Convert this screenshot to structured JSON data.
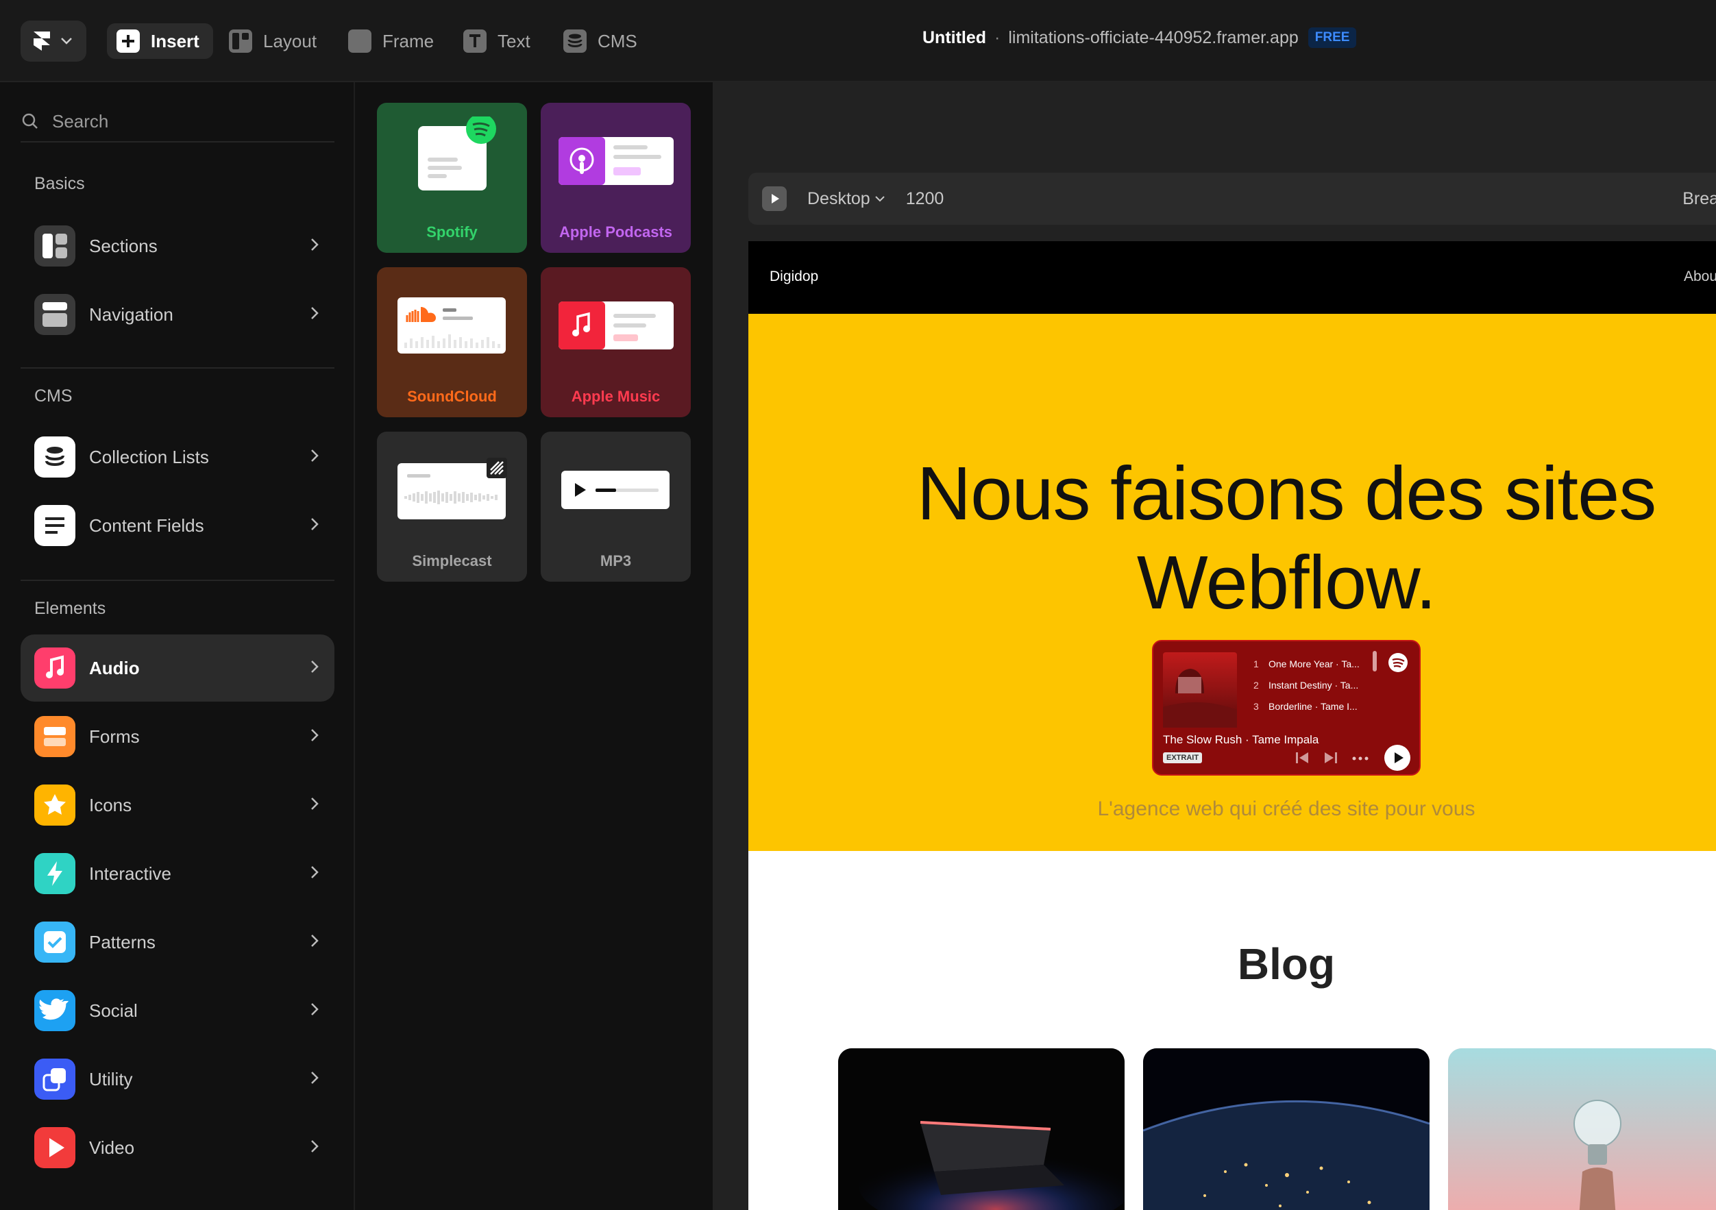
{
  "toolbar": {
    "insert": "Insert",
    "layout": "Layout",
    "frame": "Frame",
    "text": "Text",
    "cms": "CMS"
  },
  "project": {
    "name": "Untitled",
    "separator": "·",
    "url": "limitations-officiate-440952.framer.app",
    "plan": "FREE"
  },
  "sidebar": {
    "search_placeholder": "Search",
    "sections": [
      {
        "title": "Basics",
        "items": [
          {
            "label": "Sections"
          },
          {
            "label": "Navigation"
          }
        ]
      },
      {
        "title": "CMS",
        "items": [
          {
            "label": "Collection Lists"
          },
          {
            "label": "Content Fields"
          }
        ]
      },
      {
        "title": "Elements",
        "items": [
          {
            "label": "Audio",
            "active": true
          },
          {
            "label": "Forms"
          },
          {
            "label": "Icons"
          },
          {
            "label": "Interactive"
          },
          {
            "label": "Patterns"
          },
          {
            "label": "Social"
          },
          {
            "label": "Utility"
          },
          {
            "label": "Video"
          }
        ]
      }
    ]
  },
  "audio_tiles": [
    {
      "label": "Spotify",
      "bg": "#1f5b33",
      "color": "#33d36b"
    },
    {
      "label": "Apple Podcasts",
      "bg": "#4b1f59",
      "color": "#c266f0"
    },
    {
      "label": "SoundCloud",
      "bg": "#5a2c16",
      "color": "#ff6a1a"
    },
    {
      "label": "Apple Music",
      "bg": "#5a1a22",
      "color": "#ff3b4f"
    },
    {
      "label": "Simplecast",
      "bg": "#2b2b2b",
      "color": "#a5a5a5"
    },
    {
      "label": "MP3",
      "bg": "#2b2b2b",
      "color": "#a5a5a5"
    }
  ],
  "canvas": {
    "breakpoint": "Desktop",
    "width": "1200",
    "breakpoints_label": "Brea"
  },
  "site": {
    "brand": "Digidop",
    "nav_link": "Abou",
    "hero_line1": "Nous faisons des sites",
    "hero_line2": "Webflow.",
    "subtitle": "L'agence web qui créé des site pour vous",
    "blog_title": "Blog",
    "player": {
      "tracks": [
        {
          "n": "1",
          "title": "One More Year · Ta..."
        },
        {
          "n": "2",
          "title": "Instant Destiny · Ta..."
        },
        {
          "n": "3",
          "title": "Borderline · Tame I..."
        }
      ],
      "now_playing": "The Slow Rush · Tame Impala",
      "badge": "EXTRAIT"
    }
  },
  "colors": {
    "hero_bg": "#fdc500",
    "topbar_bg": "#191919",
    "accent_blue": "#3d8bff"
  }
}
